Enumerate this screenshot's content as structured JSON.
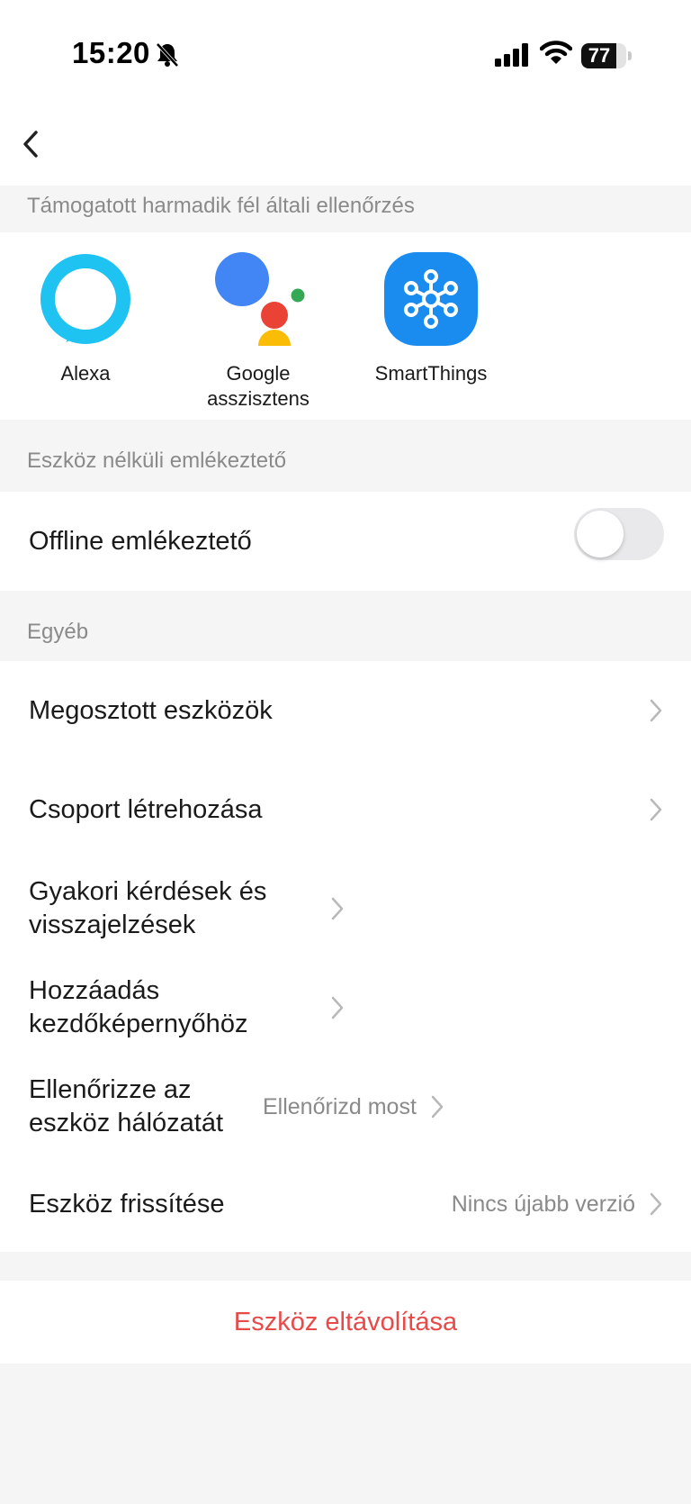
{
  "status_bar": {
    "time": "15:20",
    "battery": "77",
    "battery_level": 0.77,
    "icons": [
      "bell-slash-icon",
      "cellular-signal-icon",
      "wifi-icon",
      "battery-icon"
    ]
  },
  "nav": {
    "back_icon": "chevron-left-icon"
  },
  "sections": {
    "third_party": "Támogatott harmadik fél általi ellenőrzés",
    "offline": "Eszköz nélküli emlékeztető",
    "other": "Egyéb"
  },
  "integrations": [
    {
      "label": "Alexa",
      "icon": "alexa-icon"
    },
    {
      "label": "Google asszisztens",
      "icon": "google-assistant-icon"
    },
    {
      "label": "SmartThings",
      "icon": "smartthings-icon"
    }
  ],
  "offline_reminder": {
    "label": "Offline emlékeztető",
    "enabled": false
  },
  "other_items": [
    {
      "label": "Megosztott eszközök",
      "value": ""
    },
    {
      "label": "Csoport létrehozása",
      "value": ""
    },
    {
      "label": "Gyakori kérdések és visszajelzések",
      "value": ""
    },
    {
      "label": "Hozzáadás kezdőképernyőhöz",
      "value": ""
    },
    {
      "label": "Ellenőrizze az eszköz hálózatát",
      "value": "Ellenőrizd most"
    },
    {
      "label": "Eszköz frissítése",
      "value": "Nincs újabb verzió"
    }
  ],
  "remove_device": {
    "label": "Eszköz eltávolítása",
    "color": "#e84a4a"
  }
}
